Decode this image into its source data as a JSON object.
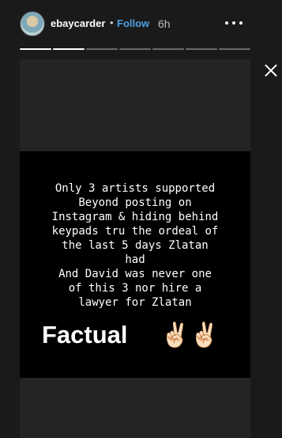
{
  "header": {
    "username": "ebaycarder",
    "separator": "•",
    "follow_label": "Follow",
    "time": "6h",
    "more_icon": "more-dots-icon",
    "close_icon": "close-icon"
  },
  "progress": {
    "segments_total": 7,
    "segments_viewed": 2
  },
  "story": {
    "text": "Only 3 artists supported\nBeyond posting on\nInstagram & hiding behind\nkeypads tru the ordeal of\nthe last 5 days Zlatan\nhad\nAnd David was never one\nof this 3 nor hire a\nlawyer for Zlatan",
    "sticker_text": "Factual",
    "emoji_1": "✌🏻",
    "emoji_2": "✌🏻"
  }
}
